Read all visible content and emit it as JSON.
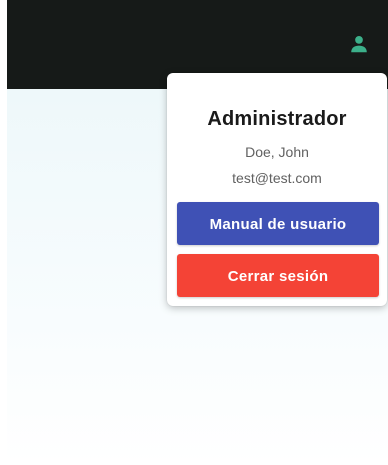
{
  "topbar": {
    "user_icon": "person-icon",
    "user_icon_color": "#3cb08a",
    "background": "#161a18"
  },
  "user_menu": {
    "role": "Administrador",
    "name": "Doe, John",
    "email": "test@test.com",
    "manual_label": "Manual de usuario",
    "logout_label": "Cerrar sesión"
  },
  "colors": {
    "primary": "#3f51b5",
    "danger": "#f44336"
  }
}
